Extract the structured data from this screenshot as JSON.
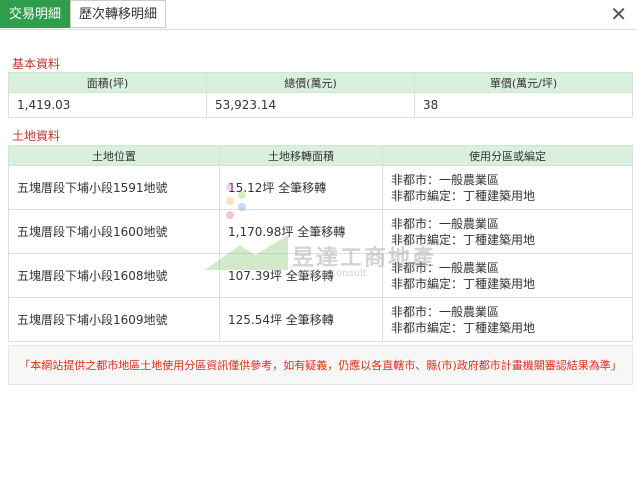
{
  "tabs": [
    {
      "label": "交易明細",
      "active": true
    },
    {
      "label": "歷次轉移明細",
      "active": false
    }
  ],
  "close_icon": "✕",
  "basic": {
    "title": "基本資料",
    "headers": [
      "面積(坪)",
      "總價(萬元)",
      "單價(萬元/坪)"
    ],
    "row": [
      "1,419.03",
      "53,923.14",
      "38"
    ]
  },
  "land": {
    "title": "土地資料",
    "headers": [
      "土地位置",
      "土地移轉面積",
      "使用分區或編定"
    ],
    "rows": [
      {
        "location": "五塊厝段下埔小段1591地號",
        "area": "15.12坪 全筆移轉",
        "zone1": "非都市：一般農業區",
        "zone2": "非都市編定：丁種建築用地"
      },
      {
        "location": "五塊厝段下埔小段1600地號",
        "area": "1,170.98坪 全筆移轉",
        "zone1": "非都市：一般農業區",
        "zone2": "非都市編定：丁種建築用地"
      },
      {
        "location": "五塊厝段下埔小段1608地號",
        "area": "107.39坪 全筆移轉",
        "zone1": "非都市：一般農業區",
        "zone2": "非都市編定：丁種建築用地"
      },
      {
        "location": "五塊厝段下埔小段1609地號",
        "area": "125.54坪 全筆移轉",
        "zone1": "非都市：一般農業區",
        "zone2": "非都市編定：丁種建築用地"
      }
    ]
  },
  "notice": "「本網站提供之都市地區土地使用分區資訊僅供參考，如有疑義，仍應以各直轄市、縣(市)政府都市計畫機關審認結果為準」",
  "watermark": {
    "text": "昱達工商地產",
    "sub": "state consult"
  },
  "colors": {
    "accent": "#2f9e4c",
    "header_bg": "#d9f0df",
    "section": "#c0392b",
    "notice": "#d9301f"
  }
}
